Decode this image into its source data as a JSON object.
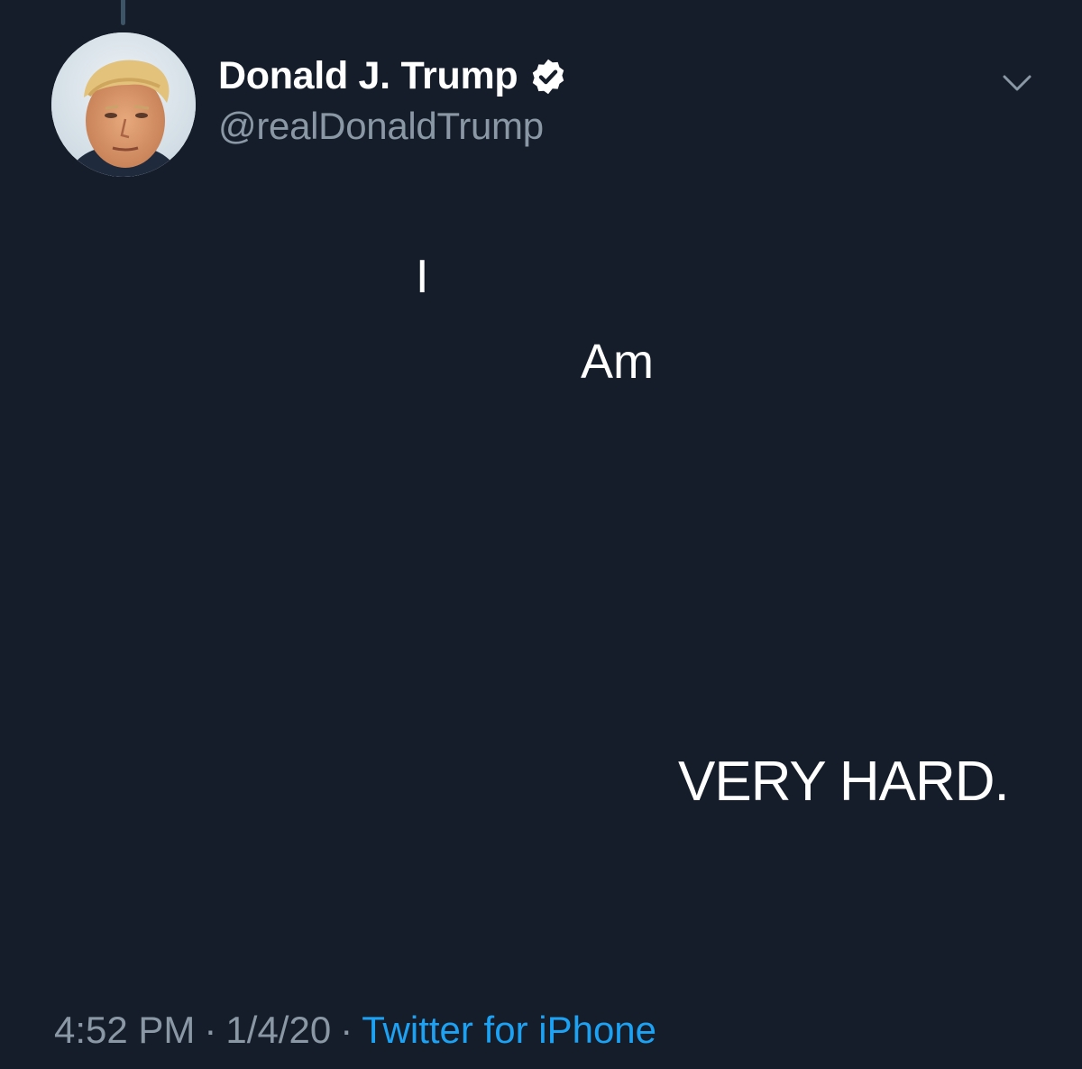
{
  "tweet": {
    "author": {
      "display_name": "Donald J. Trump",
      "handle": "@realDonaldTrump",
      "verified": true
    },
    "text_lines": [
      "I",
      "Am",
      "VERY HARD."
    ],
    "time": "4:52 PM",
    "date": "1/4/20",
    "separator": "·",
    "source": "Twitter for iPhone"
  },
  "icons": {
    "verified": "verified-badge-icon",
    "menu": "chevron-down-icon"
  },
  "colors": {
    "background": "#161d2a",
    "primary_text": "#ffffff",
    "secondary_text": "#8a98a6",
    "link": "#1da1f2",
    "thread_line": "#3d5466"
  }
}
